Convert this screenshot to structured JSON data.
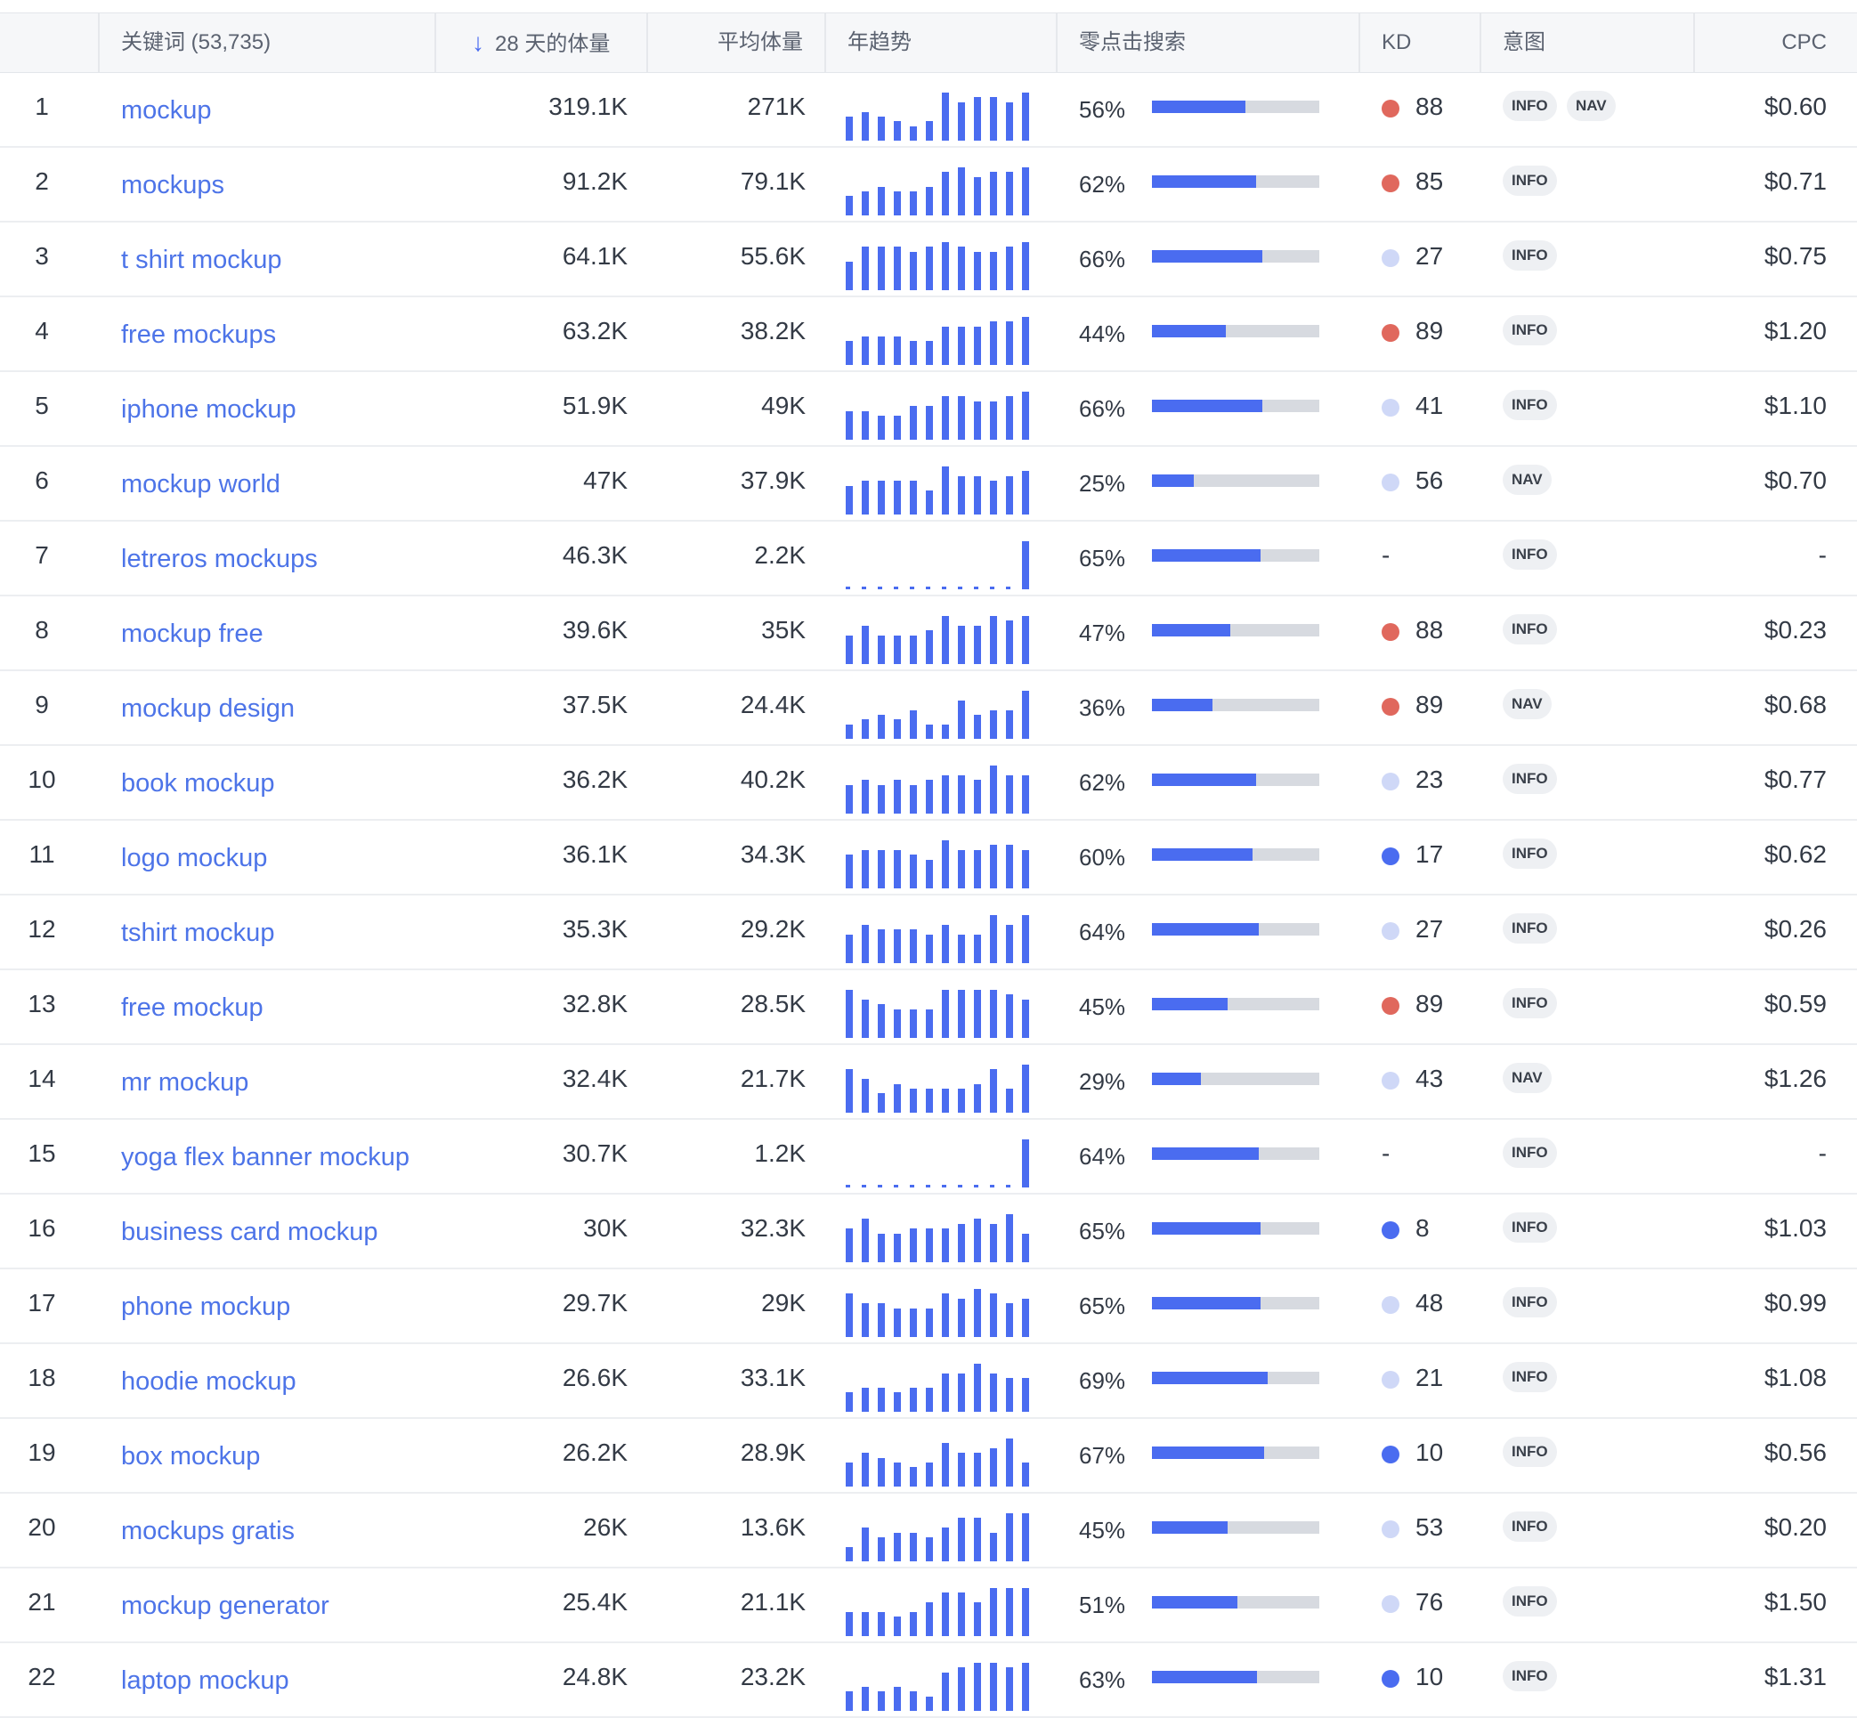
{
  "colors": {
    "accent": "#4a6cf0",
    "kd_red": "#e0685d",
    "kd_light": "#cfd8f7",
    "kd_blue": "#4a6cf0",
    "link": "#4d74e8"
  },
  "header": {
    "keyword": "关键词 (53,735)",
    "volume": "28 天的体量",
    "avg_volume": "平均体量",
    "trend": "年趋势",
    "zero_click": "零点击搜索",
    "kd": "KD",
    "intent": "意图",
    "cpc": "CPC",
    "sort_icon": "arrow-down-icon"
  },
  "rows": [
    {
      "n": "1",
      "kw": "mockup",
      "vol": "319.1K",
      "avg": "271K",
      "zc": "56%",
      "zc_val": 56,
      "kd": "88",
      "kd_level": "red",
      "intents": [
        "INFO",
        "NAV"
      ],
      "cpc": "$0.60",
      "trend": [
        5,
        6,
        5,
        4,
        3,
        4,
        10,
        8,
        9,
        9,
        8,
        10
      ]
    },
    {
      "n": "2",
      "kw": "mockups",
      "vol": "91.2K",
      "avg": "79.1K",
      "zc": "62%",
      "zc_val": 62,
      "kd": "85",
      "kd_level": "red",
      "intents": [
        "INFO"
      ],
      "cpc": "$0.71",
      "trend": [
        4,
        5,
        6,
        5,
        5,
        6,
        9,
        10,
        8,
        9,
        9,
        10
      ]
    },
    {
      "n": "3",
      "kw": "t shirt mockup",
      "vol": "64.1K",
      "avg": "55.6K",
      "zc": "66%",
      "zc_val": 66,
      "kd": "27",
      "kd_level": "light",
      "intents": [
        "INFO"
      ],
      "cpc": "$0.75",
      "trend": [
        6,
        9,
        9,
        9,
        8,
        9,
        10,
        9,
        8,
        8,
        9,
        10
      ]
    },
    {
      "n": "4",
      "kw": "free mockups",
      "vol": "63.2K",
      "avg": "38.2K",
      "zc": "44%",
      "zc_val": 44,
      "kd": "89",
      "kd_level": "red",
      "intents": [
        "INFO"
      ],
      "cpc": "$1.20",
      "trend": [
        5,
        6,
        6,
        6,
        5,
        5,
        8,
        8,
        8,
        9,
        9,
        10
      ]
    },
    {
      "n": "5",
      "kw": "iphone mockup",
      "vol": "51.9K",
      "avg": "49K",
      "zc": "66%",
      "zc_val": 66,
      "kd": "41",
      "kd_level": "light",
      "intents": [
        "INFO"
      ],
      "cpc": "$1.10",
      "trend": [
        6,
        6,
        5,
        5,
        7,
        7,
        9,
        9,
        8,
        8,
        9,
        10
      ]
    },
    {
      "n": "6",
      "kw": "mockup world",
      "vol": "47K",
      "avg": "37.9K",
      "zc": "25%",
      "zc_val": 25,
      "kd": "56",
      "kd_level": "light",
      "intents": [
        "NAV"
      ],
      "cpc": "$0.70",
      "trend": [
        6,
        7,
        7,
        7,
        7,
        5,
        10,
        8,
        8,
        7,
        8,
        9
      ]
    },
    {
      "n": "7",
      "kw": "letreros mockups",
      "vol": "46.3K",
      "avg": "2.2K",
      "zc": "65%",
      "zc_val": 65,
      "kd": "-",
      "kd_level": "none",
      "intents": [
        "INFO"
      ],
      "cpc": "-",
      "trend": "dashed"
    },
    {
      "n": "8",
      "kw": "mockup free",
      "vol": "39.6K",
      "avg": "35K",
      "zc": "47%",
      "zc_val": 47,
      "kd": "88",
      "kd_level": "red",
      "intents": [
        "INFO"
      ],
      "cpc": "$0.23",
      "trend": [
        6,
        8,
        6,
        6,
        6,
        7,
        10,
        8,
        8,
        10,
        9,
        10
      ]
    },
    {
      "n": "9",
      "kw": "mockup design",
      "vol": "37.5K",
      "avg": "24.4K",
      "zc": "36%",
      "zc_val": 36,
      "kd": "89",
      "kd_level": "red",
      "intents": [
        "NAV"
      ],
      "cpc": "$0.68",
      "trend": [
        3,
        4,
        5,
        4,
        6,
        3,
        3,
        8,
        5,
        6,
        6,
        10
      ]
    },
    {
      "n": "10",
      "kw": "book mockup",
      "vol": "36.2K",
      "avg": "40.2K",
      "zc": "62%",
      "zc_val": 62,
      "kd": "23",
      "kd_level": "light",
      "intents": [
        "INFO"
      ],
      "cpc": "$0.77",
      "trend": [
        6,
        7,
        6,
        7,
        6,
        7,
        8,
        8,
        7,
        10,
        8,
        8
      ]
    },
    {
      "n": "11",
      "kw": "logo mockup",
      "vol": "36.1K",
      "avg": "34.3K",
      "zc": "60%",
      "zc_val": 60,
      "kd": "17",
      "kd_level": "blue",
      "intents": [
        "INFO"
      ],
      "cpc": "$0.62",
      "trend": [
        7,
        8,
        8,
        8,
        7,
        6,
        10,
        8,
        8,
        9,
        9,
        8
      ]
    },
    {
      "n": "12",
      "kw": "tshirt mockup",
      "vol": "35.3K",
      "avg": "29.2K",
      "zc": "64%",
      "zc_val": 64,
      "kd": "27",
      "kd_level": "light",
      "intents": [
        "INFO"
      ],
      "cpc": "$0.26",
      "trend": [
        6,
        8,
        7,
        7,
        7,
        6,
        8,
        6,
        6,
        10,
        8,
        10
      ]
    },
    {
      "n": "13",
      "kw": "free mockup",
      "vol": "32.8K",
      "avg": "28.5K",
      "zc": "45%",
      "zc_val": 45,
      "kd": "89",
      "kd_level": "red",
      "intents": [
        "INFO"
      ],
      "cpc": "$0.59",
      "trend": [
        10,
        8,
        7,
        6,
        6,
        6,
        10,
        10,
        10,
        10,
        9,
        8
      ]
    },
    {
      "n": "14",
      "kw": "mr mockup",
      "vol": "32.4K",
      "avg": "21.7K",
      "zc": "29%",
      "zc_val": 29,
      "kd": "43",
      "kd_level": "light",
      "intents": [
        "NAV"
      ],
      "cpc": "$1.26",
      "trend": [
        9,
        7,
        4,
        6,
        5,
        5,
        5,
        5,
        6,
        9,
        5,
        10
      ]
    },
    {
      "n": "15",
      "kw": "yoga flex banner mockup",
      "vol": "30.7K",
      "avg": "1.2K",
      "zc": "64%",
      "zc_val": 64,
      "kd": "-",
      "kd_level": "none",
      "intents": [
        "INFO"
      ],
      "cpc": "-",
      "trend": "dashed"
    },
    {
      "n": "16",
      "kw": "business card mockup",
      "vol": "30K",
      "avg": "32.3K",
      "zc": "65%",
      "zc_val": 65,
      "kd": "8",
      "kd_level": "blue",
      "intents": [
        "INFO"
      ],
      "cpc": "$1.03",
      "trend": [
        7,
        9,
        6,
        6,
        7,
        7,
        7,
        8,
        9,
        8,
        10,
        6
      ]
    },
    {
      "n": "17",
      "kw": "phone mockup",
      "vol": "29.7K",
      "avg": "29K",
      "zc": "65%",
      "zc_val": 65,
      "kd": "48",
      "kd_level": "light",
      "intents": [
        "INFO"
      ],
      "cpc": "$0.99",
      "trend": [
        9,
        7,
        7,
        6,
        6,
        6,
        9,
        8,
        10,
        9,
        7,
        8
      ]
    },
    {
      "n": "18",
      "kw": "hoodie mockup",
      "vol": "26.6K",
      "avg": "33.1K",
      "zc": "69%",
      "zc_val": 69,
      "kd": "21",
      "kd_level": "light",
      "intents": [
        "INFO"
      ],
      "cpc": "$1.08",
      "trend": [
        4,
        5,
        5,
        4,
        5,
        5,
        8,
        8,
        10,
        8,
        7,
        7
      ]
    },
    {
      "n": "19",
      "kw": "box mockup",
      "vol": "26.2K",
      "avg": "28.9K",
      "zc": "67%",
      "zc_val": 67,
      "kd": "10",
      "kd_level": "blue",
      "intents": [
        "INFO"
      ],
      "cpc": "$0.56",
      "trend": [
        5,
        7,
        6,
        5,
        4,
        5,
        9,
        7,
        7,
        8,
        10,
        5
      ]
    },
    {
      "n": "20",
      "kw": "mockups gratis",
      "vol": "26K",
      "avg": "13.6K",
      "zc": "45%",
      "zc_val": 45,
      "kd": "53",
      "kd_level": "light",
      "intents": [
        "INFO"
      ],
      "cpc": "$0.20",
      "trend": [
        3,
        7,
        5,
        6,
        6,
        5,
        7,
        9,
        9,
        6,
        10,
        10
      ]
    },
    {
      "n": "21",
      "kw": "mockup generator",
      "vol": "25.4K",
      "avg": "21.1K",
      "zc": "51%",
      "zc_val": 51,
      "kd": "76",
      "kd_level": "light",
      "intents": [
        "INFO"
      ],
      "cpc": "$1.50",
      "trend": [
        5,
        5,
        5,
        4,
        5,
        7,
        9,
        9,
        7,
        10,
        10,
        10
      ]
    },
    {
      "n": "22",
      "kw": "laptop mockup",
      "vol": "24.8K",
      "avg": "23.2K",
      "zc": "63%",
      "zc_val": 63,
      "kd": "10",
      "kd_level": "blue",
      "intents": [
        "INFO"
      ],
      "cpc": "$1.31",
      "trend": [
        4,
        5,
        4,
        5,
        4,
        3,
        8,
        9,
        10,
        10,
        9,
        10
      ]
    }
  ]
}
